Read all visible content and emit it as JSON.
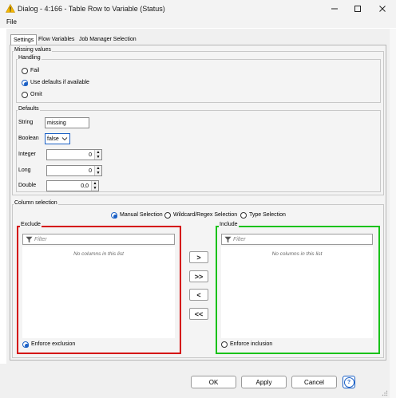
{
  "window": {
    "title": "Dialog - 4:166 - Table Row to Variable (Status)",
    "menu_file": "File"
  },
  "tabs": [
    "Settings",
    "Flow Variables",
    "Job Manager Selection"
  ],
  "missing_values": {
    "title": "Missing values",
    "handling": {
      "title": "Handling",
      "options": [
        "Fail",
        "Use defaults if available",
        "Omit"
      ],
      "selected": "Use defaults if available"
    },
    "defaults": {
      "title": "Defaults",
      "string_label": "String",
      "string_value": "missing",
      "boolean_label": "Boolean",
      "boolean_value": "false",
      "integer_label": "Integer",
      "integer_value": "0",
      "long_label": "Long",
      "long_value": "0",
      "double_label": "Double",
      "double_value": "0,0"
    }
  },
  "column_selection": {
    "title": "Column selection",
    "modes": [
      "Manual Selection",
      "Wildcard/Regex Selection",
      "Type Selection"
    ],
    "selected_mode": "Manual Selection",
    "exclude": {
      "title": "Exclude",
      "filter_placeholder": "Filter",
      "empty_text": "No columns in this list",
      "enforce_label": "Enforce exclusion",
      "enforce_selected": true,
      "border_color": "#d40000"
    },
    "include": {
      "title": "Include",
      "filter_placeholder": "Filter",
      "empty_text": "No columns in this list",
      "enforce_label": "Enforce inclusion",
      "enforce_selected": false,
      "border_color": "#19c219"
    },
    "move_buttons": [
      ">",
      ">>",
      "<",
      "<<"
    ]
  },
  "buttons": {
    "ok": "OK",
    "apply": "Apply",
    "cancel": "Cancel",
    "help": "?"
  },
  "colors": {
    "accent": "#1b60c5",
    "warning": "#f5b800"
  }
}
